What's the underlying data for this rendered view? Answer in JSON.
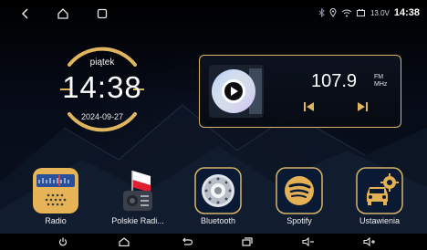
{
  "status_bar": {
    "icons": [
      "back-icon",
      "home-outline-icon",
      "recents-icon",
      "bluetooth-icon",
      "location-icon",
      "wifi-icon",
      "battery-voltage-icon"
    ],
    "voltage": "13.0V",
    "time": "14:38"
  },
  "clock": {
    "day": "piątek",
    "time": "14:38",
    "date": "2024-09-27",
    "ring_color": "#e0b560"
  },
  "radio": {
    "frequency": "107.9",
    "band_line1": "FM",
    "band_line2": "MHz",
    "accent": "#d8b466"
  },
  "apps": [
    {
      "label": "Radio",
      "icon": "radio-app-icon"
    },
    {
      "label": "Polskie Radi...",
      "icon": "polish-radio-icon"
    },
    {
      "label": "Bluetooth",
      "icon": "bluetooth-speaker-icon"
    },
    {
      "label": "Spotify",
      "icon": "spotify-icon"
    },
    {
      "label": "Ustawienia",
      "icon": "settings-car-icon"
    }
  ],
  "nav_bar": {
    "buttons": [
      "power-icon",
      "home-icon",
      "back-return-icon",
      "recent-apps-icon",
      "volume-down-icon",
      "volume-up-icon"
    ]
  }
}
